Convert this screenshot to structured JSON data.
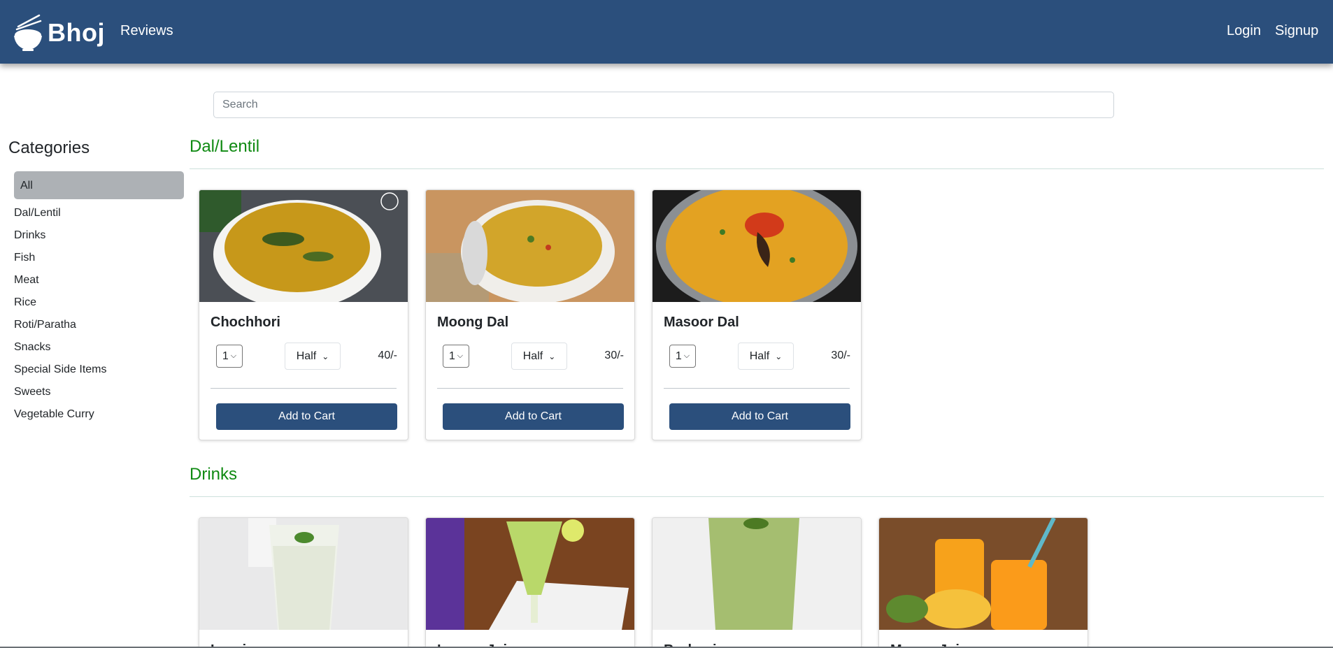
{
  "nav": {
    "brand": "Bhoj",
    "reviews": "Reviews",
    "login": "Login",
    "signup": "Signup"
  },
  "search": {
    "placeholder": "Search"
  },
  "sidebar": {
    "title": "Categories",
    "active": "All",
    "items": [
      "Dal/Lentil",
      "Drinks",
      "Fish",
      "Meat",
      "Rice",
      "Roti/Paratha",
      "Snacks",
      "Special Side Items",
      "Sweets",
      "Vegetable Curry"
    ]
  },
  "sections": [
    {
      "title": "Dal/Lentil",
      "items": [
        {
          "name": "Chochhori",
          "qty": "1",
          "size": "Half",
          "price": "40/-",
          "button": "Add to Cart"
        },
        {
          "name": "Moong Dal",
          "qty": "1",
          "size": "Half",
          "price": "30/-",
          "button": "Add to Cart"
        },
        {
          "name": "Masoor Dal",
          "qty": "1",
          "size": "Half",
          "price": "30/-",
          "button": "Add to Cart"
        }
      ]
    },
    {
      "title": "Drinks",
      "items": [
        {
          "name": "Lassi"
        },
        {
          "name": "Lemon Juice"
        },
        {
          "name": "Borhani"
        },
        {
          "name": "Mango Juice"
        }
      ]
    }
  ],
  "colors": {
    "navbar": "#2b4f7c",
    "section_title": "#0f8a12",
    "active_category": "#adb1b5",
    "button": "#2b4f7c"
  }
}
